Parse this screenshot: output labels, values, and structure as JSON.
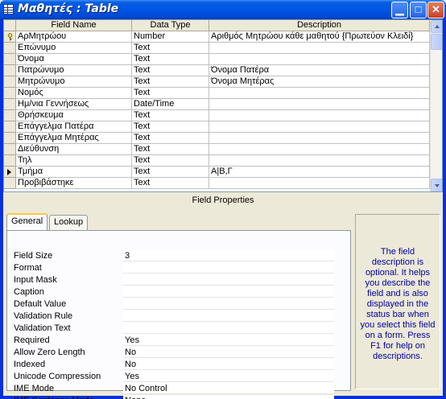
{
  "window": {
    "title": "Μαθητές : Table",
    "minimize_glyph": "▁",
    "maximize_glyph": "□",
    "close_glyph": "✕"
  },
  "grid": {
    "columns": [
      "Field Name",
      "Data Type",
      "Description"
    ],
    "rows": [
      {
        "name": "ΑρΜητρώου",
        "type": "Number",
        "description": "Αριθμός Μητρώου κάθε μαθητού {Πρωτεύον Κλειδί}",
        "selector": "key-icon"
      },
      {
        "name": "Επώνυμο",
        "type": "Text",
        "description": "",
        "selector": ""
      },
      {
        "name": "Όνομα",
        "type": "Text",
        "description": "",
        "selector": ""
      },
      {
        "name": "Πατρώνυμο",
        "type": "Text",
        "description": "Όνομα Πατέρα",
        "selector": ""
      },
      {
        "name": "Μητρώνυμο",
        "type": "Text",
        "description": "Όνομα Μητέρας",
        "selector": ""
      },
      {
        "name": "Νομός",
        "type": "Text",
        "description": "",
        "selector": ""
      },
      {
        "name": "Ημ/νια Γεννήσεως",
        "type": "Date/Time",
        "description": "",
        "selector": ""
      },
      {
        "name": "Θρήσκευμα",
        "type": "Text",
        "description": "",
        "selector": ""
      },
      {
        "name": "Επάγγελμα Πατέρα",
        "type": "Text",
        "description": "",
        "selector": ""
      },
      {
        "name": "Επάγγελμα Μητέρας",
        "type": "Text",
        "description": "",
        "selector": ""
      },
      {
        "name": "Διεύθυνση",
        "type": "Text",
        "description": "",
        "selector": ""
      },
      {
        "name": "Τηλ",
        "type": "Text",
        "description": "",
        "selector": ""
      },
      {
        "name": "Τμήμα",
        "type": "Text",
        "description": "Α|Β,Γ",
        "selector": "current-row-arrow-icon"
      },
      {
        "name": "Προβιβάστηκε",
        "type": "Text",
        "description": "",
        "selector": ""
      }
    ]
  },
  "field_properties": {
    "title": "Field Properties",
    "tabs": [
      "General",
      "Lookup"
    ],
    "active_tab": "General",
    "properties": [
      {
        "label": "Field Size",
        "value": "3"
      },
      {
        "label": "Format",
        "value": ""
      },
      {
        "label": "Input Mask",
        "value": ""
      },
      {
        "label": "Caption",
        "value": ""
      },
      {
        "label": "Default Value",
        "value": ""
      },
      {
        "label": "Validation Rule",
        "value": ""
      },
      {
        "label": "Validation Text",
        "value": ""
      },
      {
        "label": "Required",
        "value": "Yes"
      },
      {
        "label": "Allow Zero Length",
        "value": "No"
      },
      {
        "label": "Indexed",
        "value": "No"
      },
      {
        "label": "Unicode Compression",
        "value": "Yes"
      },
      {
        "label": "IME Mode",
        "value": "No Control"
      },
      {
        "label": "IME Sentence Mode",
        "value": "None"
      }
    ],
    "help_text": "The field description is optional. It helps you describe the field and is also displayed in the status bar when you select this field on a form. Press F1 for help on descriptions."
  },
  "colors": {
    "titlebar": "#0055e5",
    "help_text": "#0000a0",
    "active_tab_accent": "#ffc83c"
  }
}
